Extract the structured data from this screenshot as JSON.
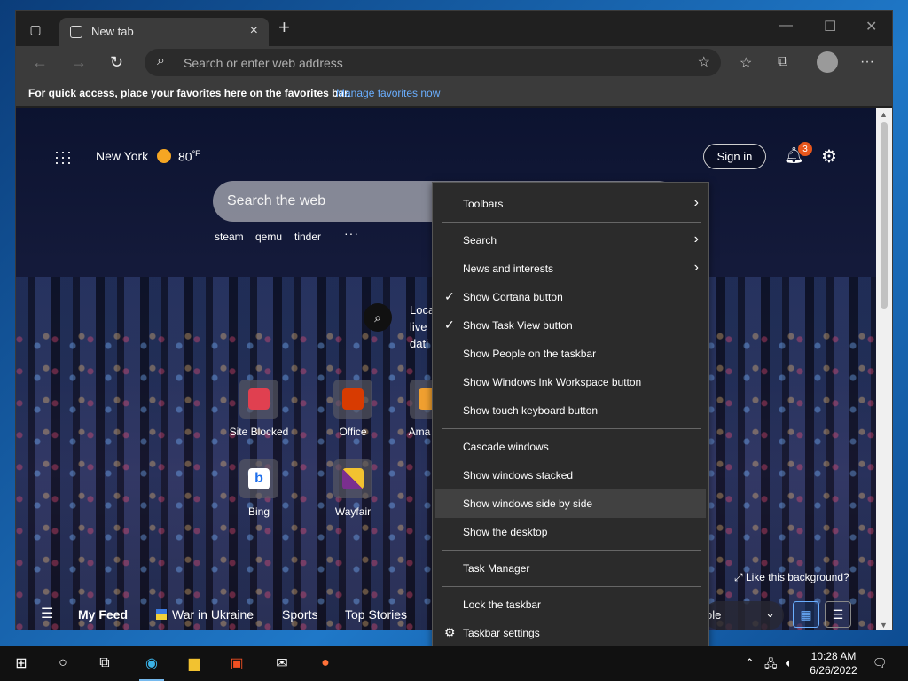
{
  "browser": {
    "tab_title": "New tab",
    "address_placeholder": "Search or enter web address",
    "favorites_bar_text": "For quick access, place your favorites here on the favorites bar.",
    "favorites_bar_link": "Manage favorites now"
  },
  "newtab": {
    "location": "New York",
    "temperature": "80",
    "temp_unit": "°F",
    "signin_label": "Sign in",
    "notification_count": "3",
    "search_placeholder": "Search the web",
    "trending": [
      "steam",
      "qemu",
      "tinder"
    ],
    "more_dots": "···",
    "local_lines": [
      "Loca",
      "live",
      "dati"
    ],
    "tiles": [
      {
        "label": "Site Blocked",
        "color": "#e04050"
      },
      {
        "label": "Office",
        "color": "#d83b01"
      },
      {
        "label": "Ama",
        "color": "#f0a030"
      },
      {
        "label": "Bing",
        "color": "#1f6feb"
      },
      {
        "label": "Wayfair",
        "color": "#7b2f8f"
      }
    ],
    "like_background": "Like this background?",
    "feed_items": [
      "My Feed",
      "War in Ukraine",
      "Sports",
      "Top Stories"
    ],
    "feed_selector": "ble"
  },
  "context_menu": {
    "items": [
      {
        "label": "Toolbars",
        "submenu": true,
        "checked": false
      },
      {
        "label": "Search",
        "submenu": true,
        "checked": false
      },
      {
        "label": "News and interests",
        "submenu": true,
        "checked": false
      },
      {
        "label": "Show Cortana button",
        "submenu": false,
        "checked": true
      },
      {
        "label": "Show Task View button",
        "submenu": false,
        "checked": true
      },
      {
        "label": "Show People on the taskbar",
        "submenu": false,
        "checked": false
      },
      {
        "label": "Show Windows Ink Workspace button",
        "submenu": false,
        "checked": false
      },
      {
        "label": "Show touch keyboard button",
        "submenu": false,
        "checked": false
      },
      {
        "label": "Cascade windows",
        "submenu": false,
        "checked": false
      },
      {
        "label": "Show windows stacked",
        "submenu": false,
        "checked": false
      },
      {
        "label": "Show windows side by side",
        "submenu": false,
        "checked": false,
        "highlighted": true
      },
      {
        "label": "Show the desktop",
        "submenu": false,
        "checked": false
      },
      {
        "label": "Task Manager",
        "submenu": false,
        "checked": false
      },
      {
        "label": "Lock the taskbar",
        "submenu": false,
        "checked": false
      },
      {
        "label": "Taskbar settings",
        "submenu": false,
        "checked": false
      }
    ]
  },
  "taskbar": {
    "time": "10:28 AM",
    "date": "6/26/2022"
  },
  "colors": {
    "accent": "#6aaeff",
    "notification_badge": "#e8561c"
  }
}
